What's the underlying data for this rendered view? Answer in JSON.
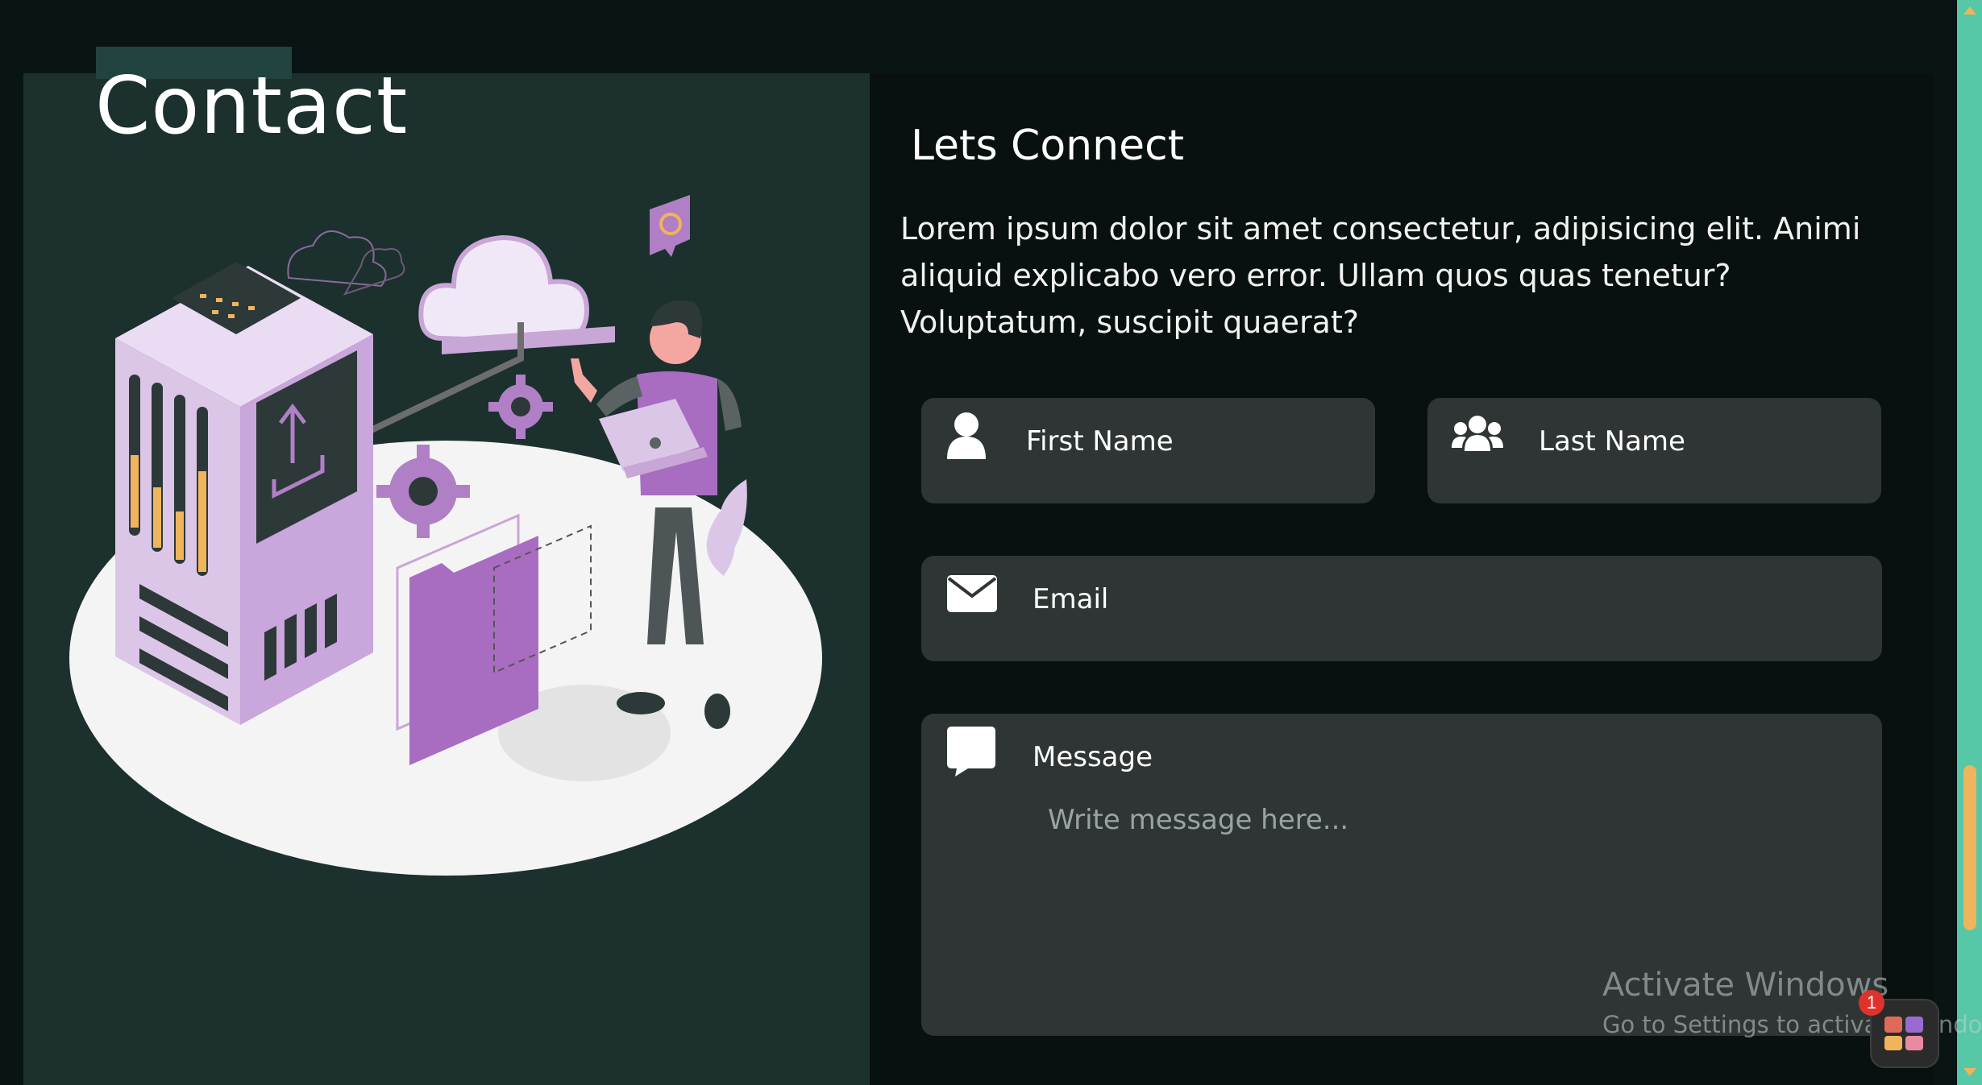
{
  "header": {
    "title": "Contact"
  },
  "contact": {
    "heading": "Lets Connect",
    "intro": "Lorem ipsum dolor sit amet consectetur, adipisicing elit. Animi aliquid explicabo vero error. Ullam quos quas tenetur? Voluptatum, suscipit quaerat?"
  },
  "form": {
    "first_name": {
      "label": "First Name",
      "icon": "user-icon",
      "value": ""
    },
    "last_name": {
      "label": "Last Name",
      "icon": "users-icon",
      "value": ""
    },
    "email": {
      "label": "Email",
      "icon": "envelope-icon",
      "value": ""
    },
    "message": {
      "label": "Message",
      "icon": "comment-icon",
      "placeholder": "Write message here..."
    }
  },
  "illustration": {
    "icon": "server-cloud-illustration"
  },
  "os_overlay": {
    "watermark_title": "Activate Windows",
    "watermark_subtitle": "Go to Settings to activate Windows.",
    "badge_count": "1"
  },
  "colors": {
    "background": "#091414",
    "left_panel": "#1c302e",
    "right_panel": "#081110",
    "field": "#2f3535",
    "accent_purple": "#a86cc1",
    "scrollbar": "#56c7a7",
    "scroll_thumb": "#f0b45c"
  }
}
